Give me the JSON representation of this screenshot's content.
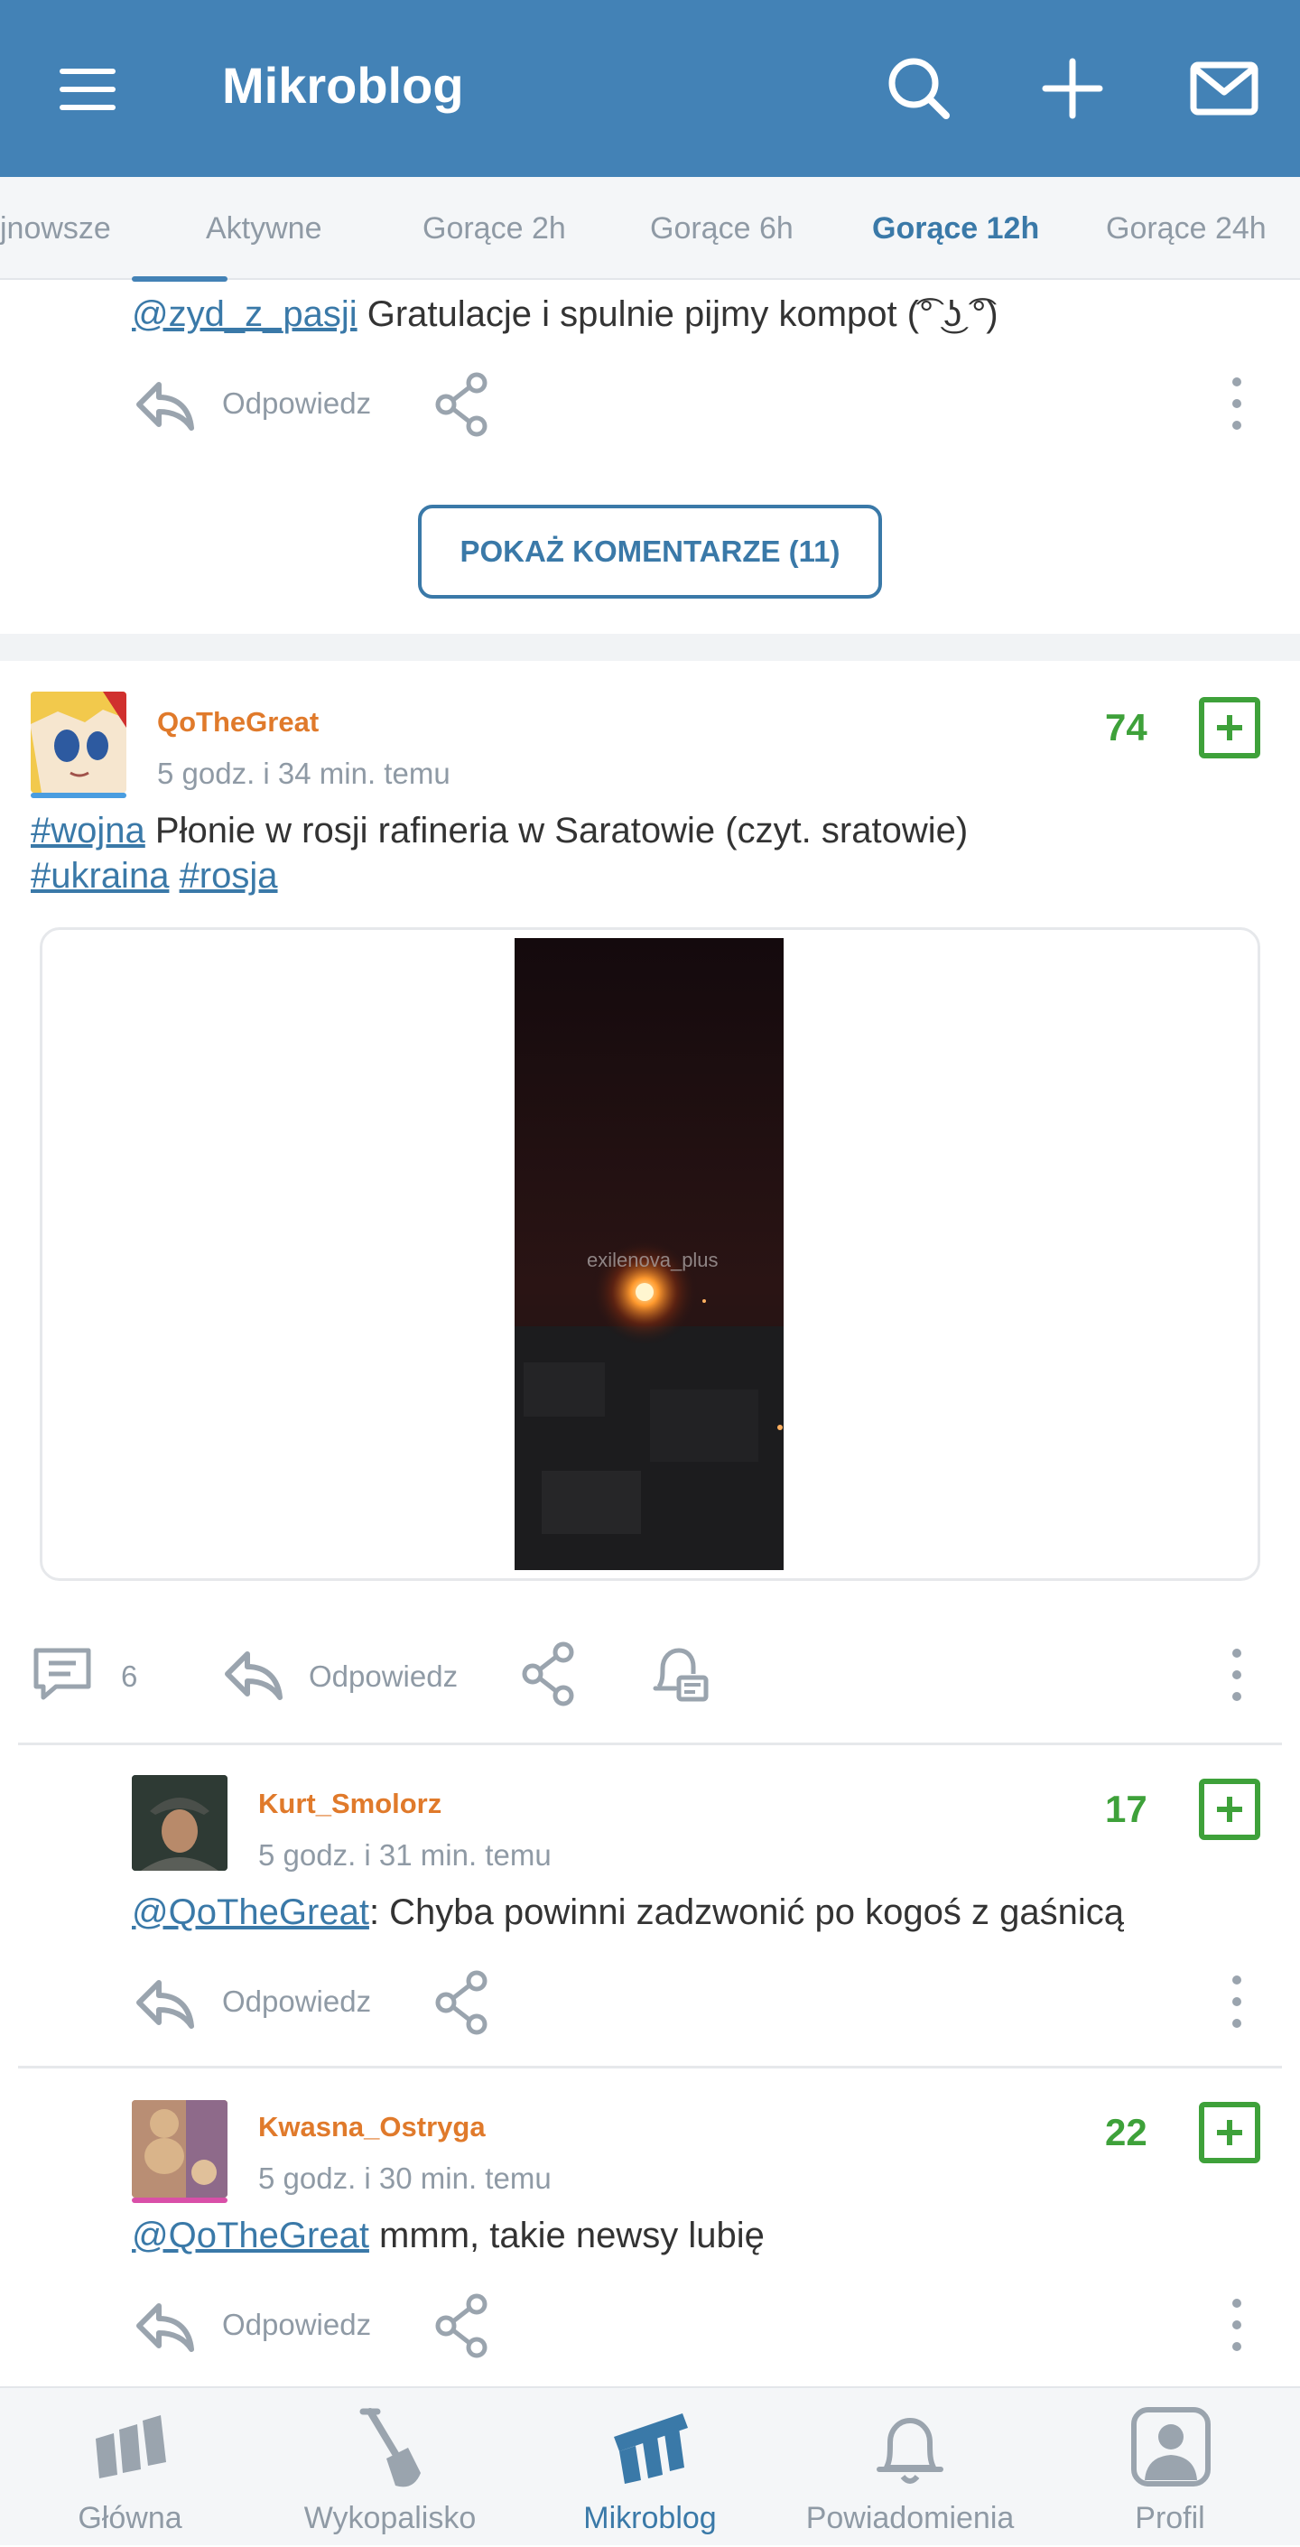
{
  "header": {
    "title": "Mikroblog",
    "icons": [
      "menu-icon",
      "search-icon",
      "plus-icon",
      "mail-icon"
    ],
    "background": "#4382b6"
  },
  "tabs": [
    {
      "label": "Najnowsze",
      "visible_text": "jnowsze",
      "active": false
    },
    {
      "label": "Aktywne",
      "active": false
    },
    {
      "label": "Gorące 2h",
      "active": false
    },
    {
      "label": "Gorące 6h",
      "active": false
    },
    {
      "label": "Gorące 12h",
      "active": true
    },
    {
      "label": "Gorące 24h",
      "active": false
    }
  ],
  "prev_comment": {
    "mention": "@zyd_z_pasji",
    "text": " Gratulacje i spulnie pijmy kompot (͡° ͜ʖ ͡°)",
    "reply_label": "Odpowiedz"
  },
  "show_comments_label": "POKAŻ KOMENTARZE (11)",
  "post": {
    "author": "QoTheGreat",
    "time": "5 godz. i 34 min. temu",
    "votes": "74",
    "tag1": "#wojna",
    "text": " Płonie w rosji rafineria w Saratowie (czyt. sratowie)",
    "tag2": "#ukraina",
    "tag3": "#rosja",
    "video_watermark": "exilenova_plus",
    "comment_count": "6",
    "reply_label": "Odpowiedz"
  },
  "comments": [
    {
      "author": "Kurt_Smolorz",
      "time": "5 godz. i 31 min. temu",
      "votes": "17",
      "mention": "@QoTheGreat",
      "text": ":  Chyba powinni zadzwonić po kogoś z gaśnicą",
      "reply_label": "Odpowiedz"
    },
    {
      "author": "Kwasna_Ostryga",
      "time": "5 godz. i 30 min. temu",
      "votes": "22",
      "mention": "@QoTheGreat",
      "text": " mmm, takie newsy lubię",
      "reply_label": "Odpowiedz"
    }
  ],
  "bottom_nav": [
    {
      "label": "Główna",
      "icon": "wykop-logo-icon",
      "active": false
    },
    {
      "label": "Wykopalisko",
      "icon": "shovel-icon",
      "active": false
    },
    {
      "label": "Mikroblog",
      "icon": "mikroblog-logo-icon",
      "active": true
    },
    {
      "label": "Powiadomienia",
      "icon": "bell-icon",
      "active": false
    },
    {
      "label": "Profil",
      "icon": "profile-icon",
      "active": false
    }
  ],
  "colors": {
    "accent": "#3a79a8",
    "vote_green": "#3ea13a",
    "author_orange": "#e07a2b",
    "muted": "#8f9aa5"
  }
}
